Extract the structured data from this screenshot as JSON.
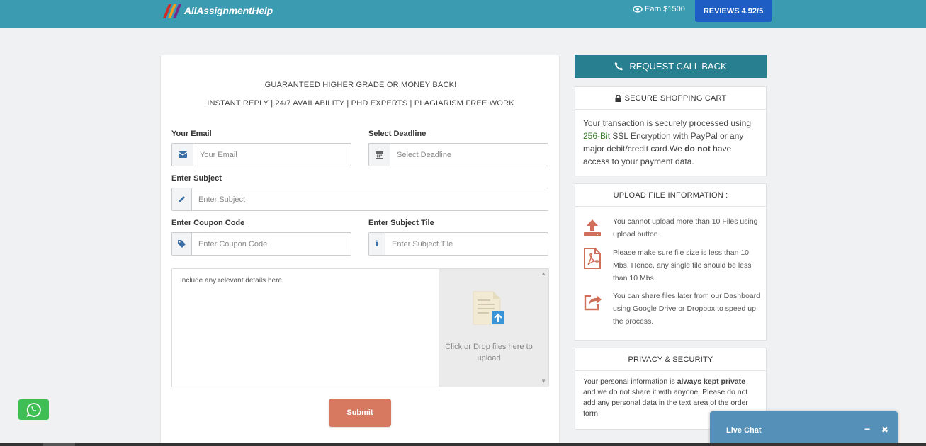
{
  "header": {
    "logo_text": "AllAssignmentHelp",
    "earn_text": "Earn $1500",
    "reviews_label": "REVIEWS 4.92/5"
  },
  "form": {
    "headline1": "GUARANTEED HIGHER GRADE OR MONEY BACK!",
    "headline2": "INSTANT REPLY | 24/7 AVAILABILITY | PHD EXPERTS | PLAGIARISM FREE WORK",
    "email_label": "Your Email",
    "email_placeholder": "Your Email",
    "deadline_label": "Select Deadline",
    "deadline_placeholder": "Select Deadline",
    "subject_label": "Enter Subject",
    "subject_placeholder": "Enter Subject",
    "coupon_label": "Enter Coupon Code",
    "coupon_placeholder": "Enter Coupon Code",
    "title_label": "Enter Subject Tile",
    "title_placeholder": "Enter Subject Tile",
    "details_placeholder": "Include any relevant details here",
    "upload_text": "Click or Drop files here to upload",
    "submit_label": "Submit"
  },
  "sidebar": {
    "callback_label": "REQUEST CALL BACK",
    "secure": {
      "title": "SECURE SHOPPING CART",
      "text_a": "Your transaction is securely processed using ",
      "text_highlight": "256-Bit",
      "text_b": " SSL Encryption with PayPal or any major debit/credit card.We ",
      "text_bold": "do not",
      "text_c": " have access to your payment data."
    },
    "upload_info": {
      "title": "UPLOAD FILE INFORMATION :",
      "items": [
        {
          "icon": "upload-icon",
          "text": "You cannot upload more than 10 Files using upload button."
        },
        {
          "icon": "pdf-file-icon",
          "text": "Please make sure file size is less than 10 Mbs. Hence, any single file should be less than 10 Mbs."
        },
        {
          "icon": "share-icon",
          "text": "You can share files later from our Dashboard using Google Drive or Dropbox to speed up the process."
        }
      ]
    },
    "privacy": {
      "title": "PRIVACY & SECURITY",
      "text_a": "Your personal information is ",
      "text_bold": "always kept private",
      "text_b": " and we do not share it with anyone. Please do not add any personal data in the text area of the order form."
    }
  },
  "livechat": {
    "title": "Live Chat",
    "minimize": "−",
    "close": "✖"
  },
  "colors": {
    "header_bg": "#3a9bb1",
    "reviews_bg": "#1e5ec4",
    "callback_bg": "#277f90",
    "submit_bg": "#d77860",
    "icon_accent": "#d0705a",
    "whatsapp_bg": "#3fbf53",
    "livechat_bg": "#5490b8"
  }
}
